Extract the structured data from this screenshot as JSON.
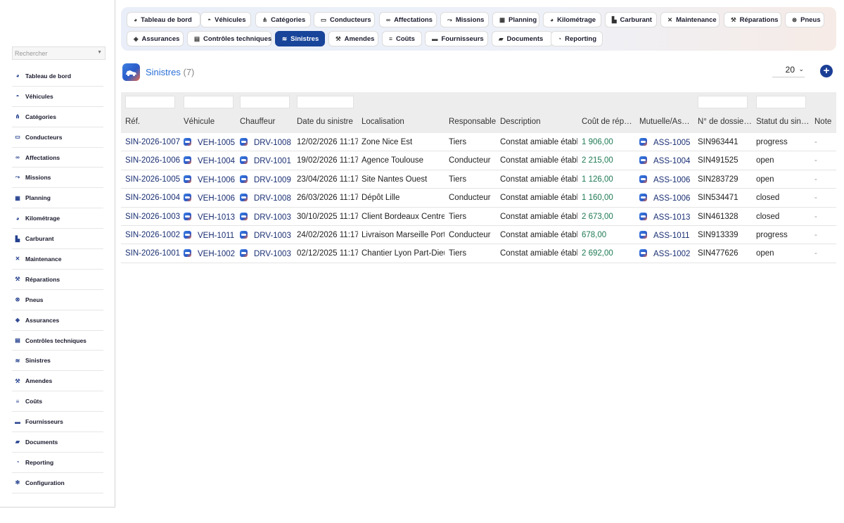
{
  "search": {
    "placeholder": "Rechercher"
  },
  "sidebar": {
    "items": [
      {
        "label": "Tableau de bord",
        "icon": "gauge-icon",
        "glyph": "◕"
      },
      {
        "label": "Véhicules",
        "icon": "car-icon",
        "glyph": "◓"
      },
      {
        "label": "Catégories",
        "icon": "sitemap-icon",
        "glyph": "⋔"
      },
      {
        "label": "Conducteurs",
        "icon": "id-card-icon",
        "glyph": "▭"
      },
      {
        "label": "Affectations",
        "icon": "link-icon",
        "glyph": "∞"
      },
      {
        "label": "Missions",
        "icon": "route-icon",
        "glyph": "⤳"
      },
      {
        "label": "Planning",
        "icon": "calendar-icon",
        "glyph": "▦"
      },
      {
        "label": "Kilométrage",
        "icon": "tachometer-icon",
        "glyph": "◕"
      },
      {
        "label": "Carburant",
        "icon": "gas-pump-icon",
        "glyph": "▙"
      },
      {
        "label": "Maintenance",
        "icon": "tools-icon",
        "glyph": "✕"
      },
      {
        "label": "Réparations",
        "icon": "wrench-icon",
        "glyph": "⚒"
      },
      {
        "label": "Pneus",
        "icon": "tire-icon",
        "glyph": "⊗"
      },
      {
        "label": "Assurances",
        "icon": "shield-icon",
        "glyph": "◈"
      },
      {
        "label": "Contrôles techniques",
        "icon": "clipboard-check-icon",
        "glyph": "▤"
      },
      {
        "label": "Sinistres",
        "icon": "car-crash-icon",
        "glyph": "≋"
      },
      {
        "label": "Amendes",
        "icon": "gavel-icon",
        "glyph": "⚒"
      },
      {
        "label": "Coûts",
        "icon": "coins-icon",
        "glyph": "≡"
      },
      {
        "label": "Fournisseurs",
        "icon": "warehouse-icon",
        "glyph": "▬"
      },
      {
        "label": "Documents",
        "icon": "folder-icon",
        "glyph": "▰"
      },
      {
        "label": "Reporting",
        "icon": "chart-pie-icon",
        "glyph": "◔"
      },
      {
        "label": "Configuration",
        "icon": "gear-icon",
        "glyph": "✻"
      }
    ]
  },
  "topnav": {
    "tabs": [
      {
        "label": "Tableau de bord",
        "icon": "gauge-icon",
        "glyph": "◕"
      },
      {
        "label": "Véhicules",
        "icon": "car-icon",
        "glyph": "◓"
      },
      {
        "label": "Catégories",
        "icon": "sitemap-icon",
        "glyph": "⋔"
      },
      {
        "label": "Conducteurs",
        "icon": "id-card-icon",
        "glyph": "▭"
      },
      {
        "label": "Affectations",
        "icon": "link-icon",
        "glyph": "∞"
      },
      {
        "label": "Missions",
        "icon": "route-icon",
        "glyph": "⤳"
      },
      {
        "label": "Planning",
        "icon": "calendar-icon",
        "glyph": "▦"
      },
      {
        "label": "Kilométrage",
        "icon": "tachometer-icon",
        "glyph": "◕"
      },
      {
        "label": "Carburant",
        "icon": "gas-pump-icon",
        "glyph": "▙"
      },
      {
        "label": "Maintenance",
        "icon": "tools-icon",
        "glyph": "✕"
      },
      {
        "label": "Réparations",
        "icon": "wrench-icon",
        "glyph": "⚒"
      },
      {
        "label": "Pneus",
        "icon": "tire-icon",
        "glyph": "⊗"
      },
      {
        "label": "Assurances",
        "icon": "shield-icon",
        "glyph": "◈"
      },
      {
        "label": "Contrôles techniques",
        "icon": "clipboard-check-icon",
        "glyph": "▤"
      },
      {
        "label": "Sinistres",
        "icon": "car-crash-icon",
        "glyph": "≋",
        "active": true
      },
      {
        "label": "Amendes",
        "icon": "gavel-icon",
        "glyph": "⚒"
      },
      {
        "label": "Coûts",
        "icon": "coins-icon",
        "glyph": "≡"
      },
      {
        "label": "Fournisseurs",
        "icon": "warehouse-icon",
        "glyph": "▬"
      },
      {
        "label": "Documents",
        "icon": "folder-icon",
        "glyph": "▰"
      },
      {
        "label": "Reporting",
        "icon": "chart-pie-icon",
        "glyph": "◔"
      }
    ]
  },
  "page": {
    "title": "Sinistres",
    "count": "(7)",
    "page_size": "20",
    "accent": "#2a6fd6",
    "active_tab_color": "#18449a",
    "money_color": "#1f7a54"
  },
  "table": {
    "columns": [
      "Réf.",
      "Véhicule",
      "Chauffeur",
      "Date du sinistre",
      "Localisation",
      "Responsable",
      "Description",
      "Coût de répa…",
      "Mutuelle/Ass…",
      "N° de dossie…",
      "Statut du sini…",
      "Note"
    ],
    "rows": [
      {
        "ref": "SIN-2026-1007",
        "vehicle": "VEH-1005",
        "driver": "DRV-1008",
        "date": "12/02/2026 11:17",
        "location": "Zone Nice Est",
        "responsible": "Tiers",
        "description": "Constat amiable établi",
        "cost": "1 906,00",
        "insurer": "ASS-1005",
        "file_no": "SIN963441",
        "status": "progress",
        "note": "-"
      },
      {
        "ref": "SIN-2026-1006",
        "vehicle": "VEH-1004",
        "driver": "DRV-1001",
        "date": "19/02/2026 11:17",
        "location": "Agence Toulouse",
        "responsible": "Conducteur",
        "description": "Constat amiable établi",
        "cost": "2 215,00",
        "insurer": "ASS-1004",
        "file_no": "SIN491525",
        "status": "open",
        "note": "-"
      },
      {
        "ref": "SIN-2026-1005",
        "vehicle": "VEH-1006",
        "driver": "DRV-1009",
        "date": "23/04/2026 11:17",
        "location": "Site Nantes Ouest",
        "responsible": "Tiers",
        "description": "Constat amiable établi",
        "cost": "1 126,00",
        "insurer": "ASS-1006",
        "file_no": "SIN283729",
        "status": "open",
        "note": "-"
      },
      {
        "ref": "SIN-2026-1004",
        "vehicle": "VEH-1006",
        "driver": "DRV-1008",
        "date": "26/03/2026 11:17",
        "location": "Dépôt Lille",
        "responsible": "Conducteur",
        "description": "Constat amiable établi",
        "cost": "1 160,00",
        "insurer": "ASS-1006",
        "file_no": "SIN534471",
        "status": "closed",
        "note": "-"
      },
      {
        "ref": "SIN-2026-1003",
        "vehicle": "VEH-1013",
        "driver": "DRV-1003",
        "date": "30/10/2025 11:17",
        "location": "Client Bordeaux Centre",
        "responsible": "Tiers",
        "description": "Constat amiable établi",
        "cost": "2 673,00",
        "insurer": "ASS-1013",
        "file_no": "SIN461328",
        "status": "closed",
        "note": "-"
      },
      {
        "ref": "SIN-2026-1002",
        "vehicle": "VEH-1011",
        "driver": "DRV-1003",
        "date": "24/02/2026 11:17",
        "location": "Livraison Marseille Port",
        "responsible": "Conducteur",
        "description": "Constat amiable établi",
        "cost": "678,00",
        "insurer": "ASS-1011",
        "file_no": "SIN913339",
        "status": "progress",
        "note": "-"
      },
      {
        "ref": "SIN-2026-1001",
        "vehicle": "VEH-1002",
        "driver": "DRV-1003",
        "date": "02/12/2025 11:17",
        "location": "Chantier Lyon Part-Dieu",
        "responsible": "Tiers",
        "description": "Constat amiable établi",
        "cost": "2 692,00",
        "insurer": "ASS-1002",
        "file_no": "SIN477626",
        "status": "open",
        "note": "-"
      }
    ]
  }
}
